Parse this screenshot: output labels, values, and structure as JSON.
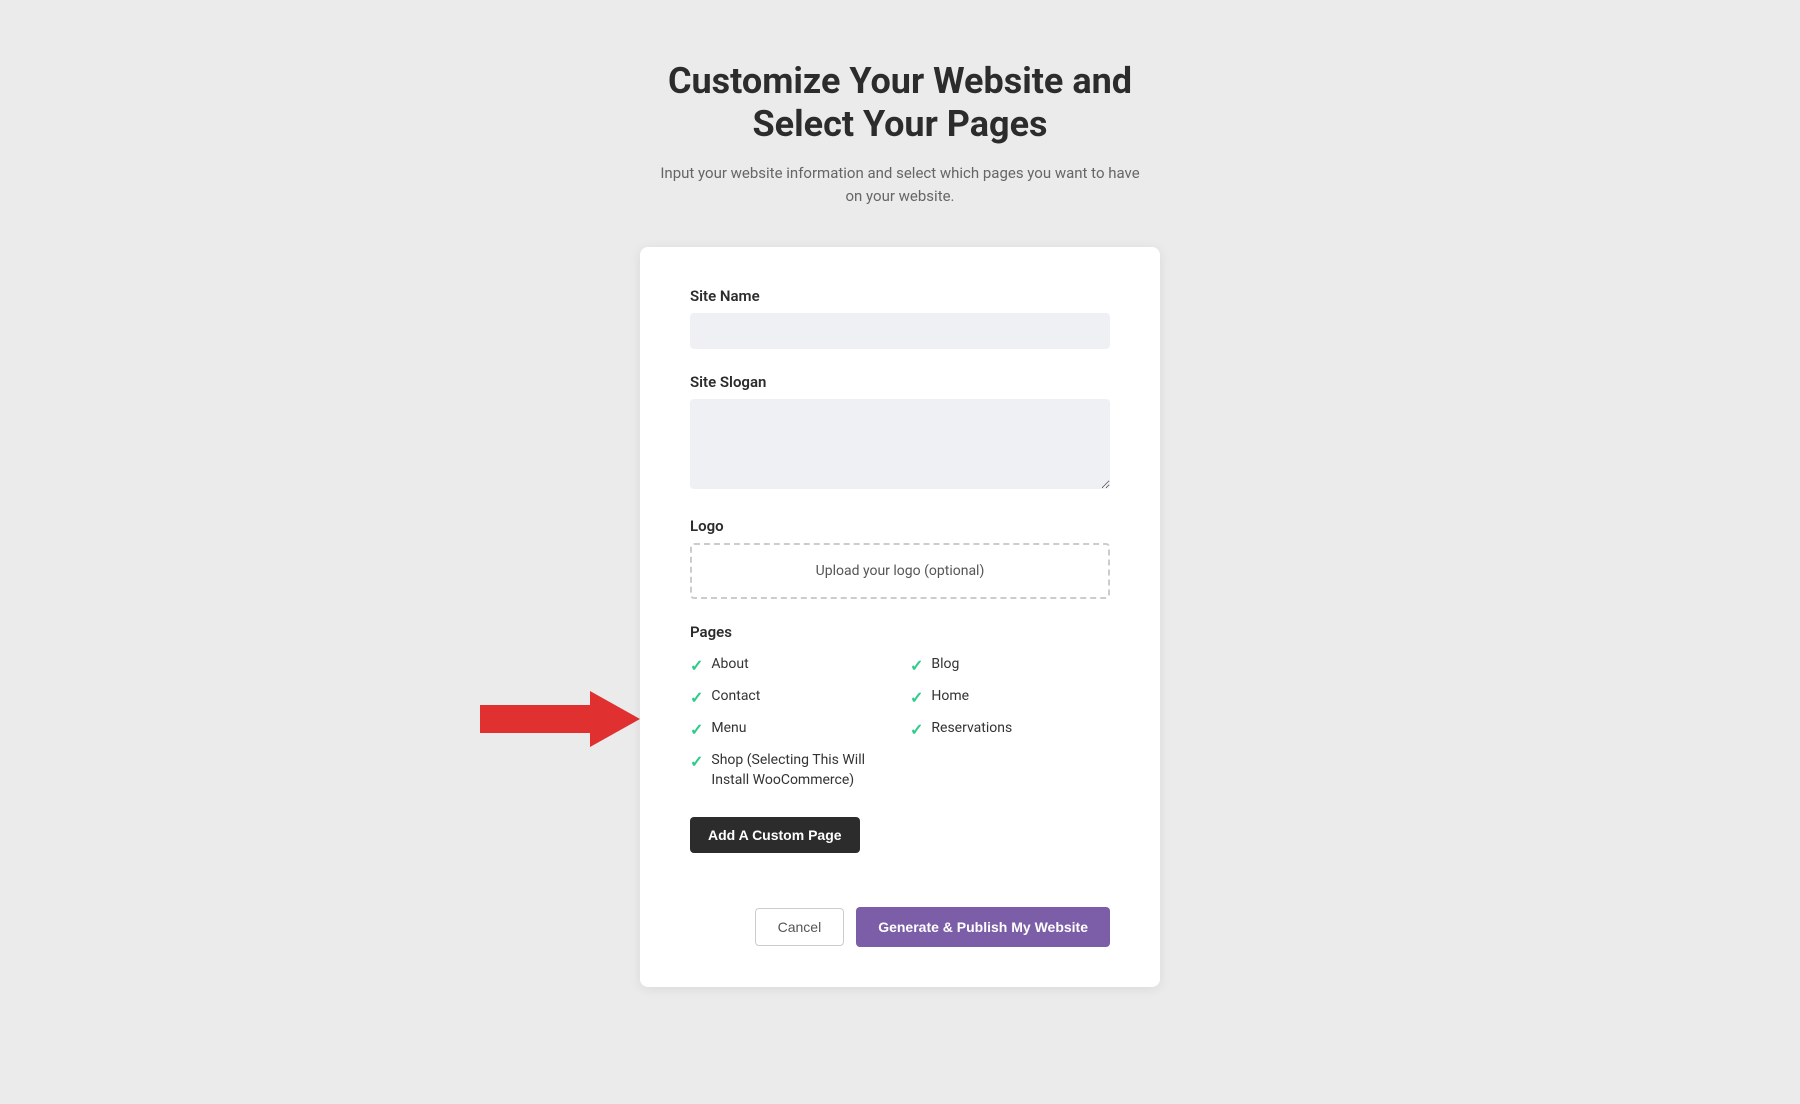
{
  "header": {
    "title": "Customize Your Website and\nSelect Your Pages",
    "subtitle": "Input your website information and select which pages you want to have\non your website."
  },
  "form": {
    "site_name": {
      "label": "Site Name",
      "placeholder": ""
    },
    "site_slogan": {
      "label": "Site Slogan",
      "placeholder": ""
    },
    "logo": {
      "label": "Logo",
      "upload_text": "Upload your logo (optional)"
    },
    "pages": {
      "label": "Pages",
      "items": [
        {
          "id": "about",
          "label": "About",
          "checked": true,
          "col": 1
        },
        {
          "id": "blog",
          "label": "Blog",
          "checked": true,
          "col": 2
        },
        {
          "id": "contact",
          "label": "Contact",
          "checked": true,
          "col": 1
        },
        {
          "id": "home",
          "label": "Home",
          "checked": true,
          "col": 2
        },
        {
          "id": "menu",
          "label": "Menu",
          "checked": true,
          "col": 1
        },
        {
          "id": "reservations",
          "label": "Reservations",
          "checked": true,
          "col": 2
        },
        {
          "id": "shop",
          "label": "Shop (Selecting This Will Install WooCommerce)",
          "checked": true,
          "col": 1
        }
      ]
    },
    "add_custom_page_btn": "Add A Custom Page",
    "cancel_btn": "Cancel",
    "generate_btn": "Generate & Publish My Website"
  }
}
